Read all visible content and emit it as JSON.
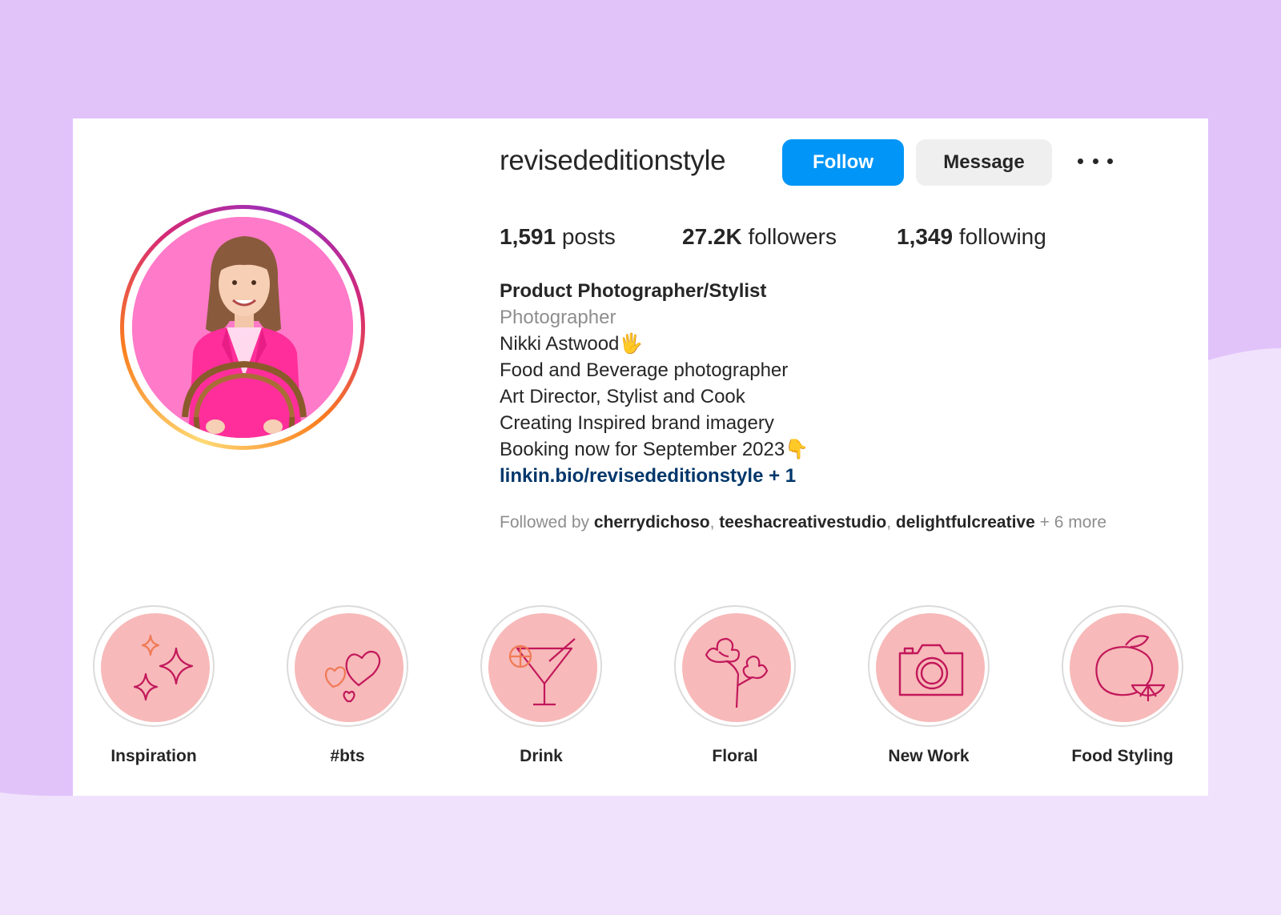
{
  "profile": {
    "username": "revisededitionstyle",
    "follow_label": "Follow",
    "message_label": "Message",
    "stats": {
      "posts_count": "1,591",
      "posts_label": "posts",
      "followers_count": "27.2K",
      "followers_label": "followers",
      "following_count": "1,349",
      "following_label": "following"
    },
    "bio": {
      "name": "Product Photographer/Stylist",
      "category": "Photographer",
      "lines": [
        "Nikki Astwood🖐",
        "Food and Beverage photographer",
        "Art Director, Stylist and Cook",
        "Creating Inspired brand imagery",
        "Booking now for September 2023👇"
      ],
      "link": "linkin.bio/revisededitionstyle + 1"
    },
    "followed_by": {
      "prefix": "Followed by ",
      "users": [
        "cherrydichoso",
        "teeshacreativestudio",
        "delightfulcreative"
      ],
      "separator": ", ",
      "suffix": " + 6 more"
    }
  },
  "highlights": [
    {
      "label": "Inspiration",
      "icon": "sparkles-icon"
    },
    {
      "label": "#bts",
      "icon": "hearts-icon"
    },
    {
      "label": "Drink",
      "icon": "cocktail-icon"
    },
    {
      "label": "Floral",
      "icon": "flower-icon"
    },
    {
      "label": "New Work",
      "icon": "camera-icon"
    },
    {
      "label": "Food Styling",
      "icon": "lemon-icon"
    }
  ],
  "colors": {
    "background": "#e1c3fa",
    "follow_button": "#0095f6",
    "highlight_fill": "#f7b9b9",
    "highlight_icon": "#c2185b",
    "link": "#00376b"
  }
}
